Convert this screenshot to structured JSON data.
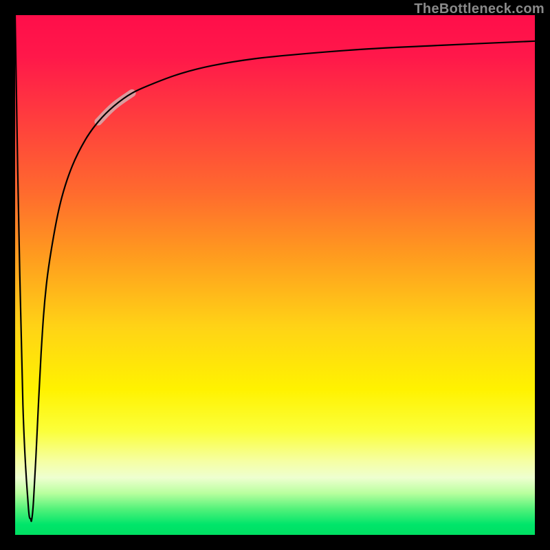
{
  "attribution": "TheBottleneck.com",
  "colors": {
    "frame": "#000000",
    "gradient_top": "#ff0e4a",
    "gradient_mid": "#fff200",
    "gradient_bottom": "#00df62",
    "curve": "#000000",
    "highlight": "#d9a0a2"
  },
  "chart_data": {
    "type": "line",
    "title": "",
    "xlabel": "",
    "ylabel": "",
    "xlim": [
      0,
      100
    ],
    "ylim": [
      0,
      100
    ],
    "grid": false,
    "series": [
      {
        "name": "bottleneck-curve",
        "x": [
          0.0,
          0.5,
          1.5,
          2.5,
          3.0,
          3.2,
          3.5,
          4.0,
          5.0,
          6.0,
          7.5,
          9.0,
          11.0,
          13.5,
          16.0,
          19.0,
          22.5,
          27.0,
          32.0,
          38.0,
          46.0,
          56.0,
          68.0,
          82.0,
          100.0
        ],
        "y": [
          100.0,
          70.0,
          25.0,
          6.0,
          3.0,
          3.0,
          6.0,
          15.0,
          35.0,
          48.0,
          58.0,
          65.0,
          71.0,
          76.0,
          79.5,
          82.5,
          85.0,
          87.0,
          88.8,
          90.3,
          91.6,
          92.6,
          93.5,
          94.2,
          95.0
        ]
      }
    ],
    "highlight_range_x": [
      15,
      23
    ],
    "annotations": []
  }
}
